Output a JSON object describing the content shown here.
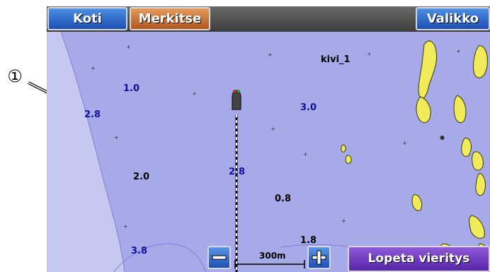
{
  "toolbar": {
    "home_label": "Koti",
    "mark_label": "Merkitse",
    "menu_label": "Valikko"
  },
  "bottom": {
    "stop_scroll_label": "Lopeta vieritys",
    "scale_text": "300m"
  },
  "callout": {
    "number": "①"
  },
  "waypoint": {
    "name": "kivi_1"
  },
  "depths": {
    "d1": "1.0",
    "d2": "2.8",
    "d3": "3.0",
    "d4": "2.0",
    "d5": "2.8",
    "d6": "0.8",
    "d7": "1.8",
    "d8": "3.8"
  },
  "colors": {
    "water": "#a7aae8",
    "shallow": "#c6c8f2",
    "land": "#f1ea5a",
    "accent_blue": "#1c4fb3",
    "accent_orange": "#b0561b",
    "accent_purple": "#5723a8"
  }
}
